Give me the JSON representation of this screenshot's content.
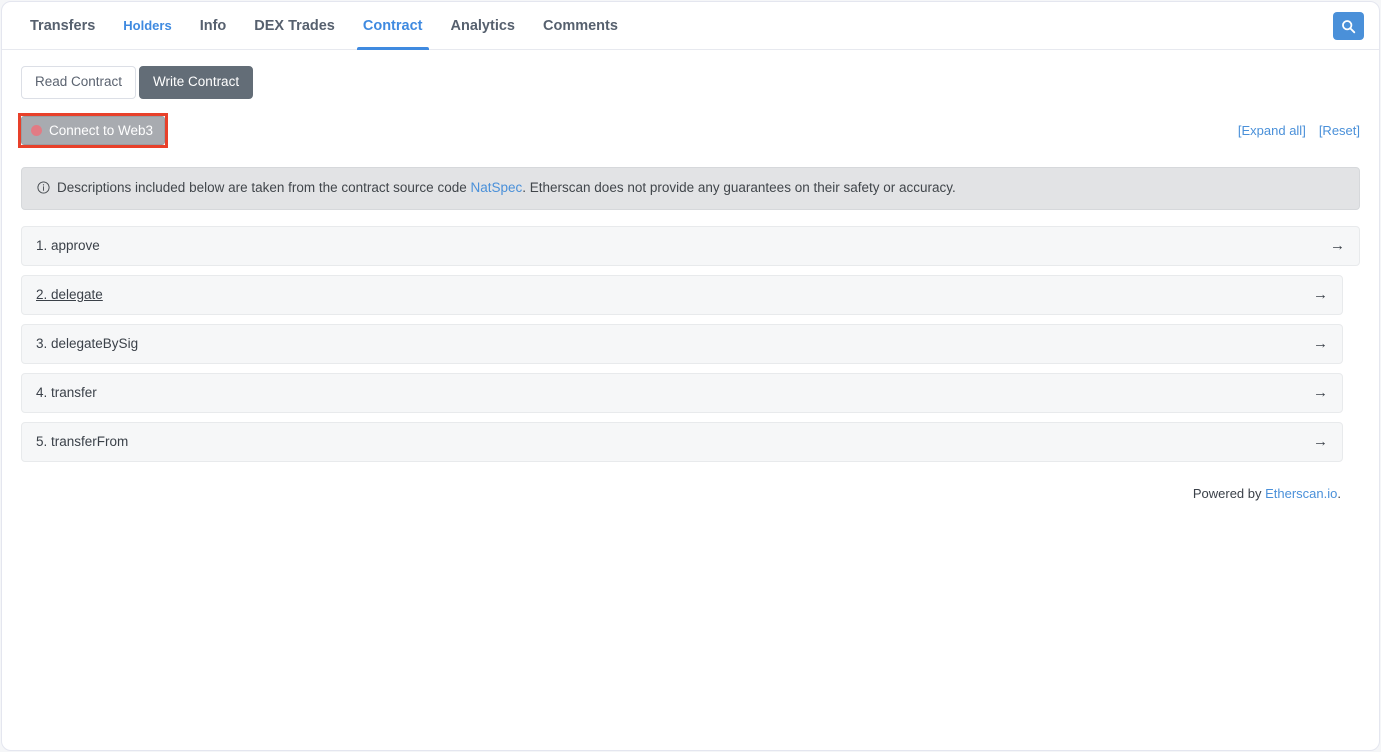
{
  "nav": {
    "tabs": [
      {
        "label": "Transfers",
        "state": "default"
      },
      {
        "label": "Holders",
        "state": "link"
      },
      {
        "label": "Info",
        "state": "default"
      },
      {
        "label": "DEX Trades",
        "state": "default"
      },
      {
        "label": "Contract",
        "state": "active"
      },
      {
        "label": "Analytics",
        "state": "default"
      },
      {
        "label": "Comments",
        "state": "default"
      }
    ],
    "search_icon": "search-icon"
  },
  "mode_buttons": {
    "read_label": "Read Contract",
    "write_label": "Write Contract",
    "active": "Write Contract"
  },
  "connect": {
    "label": "Connect to Web3",
    "status_dot_icon": "status-dot-icon",
    "status_dot_color": "#e27b84",
    "highlight_color": "#e8402a",
    "button_color": "#a8abb0"
  },
  "actions": {
    "expand_all": "[Expand all]",
    "reset": "[Reset]"
  },
  "notice": {
    "icon": "info-circle-icon",
    "text_before": "Descriptions included below are taken from the contract source code",
    "link_text": "NatSpec",
    "text_after": ". Etherscan does not provide any guarantees on their safety or accuracy."
  },
  "functions": [
    {
      "label": "1. approve",
      "arrow_icon": "arrow-right-icon",
      "hover": false,
      "expanded_width": true
    },
    {
      "label": "2. delegate",
      "arrow_icon": "arrow-right-icon",
      "hover": true,
      "expanded_width": false
    },
    {
      "label": "3. delegateBySig",
      "arrow_icon": "arrow-right-icon",
      "hover": false,
      "expanded_width": false
    },
    {
      "label": "4. transfer",
      "arrow_icon": "arrow-right-icon",
      "hover": false,
      "expanded_width": false
    },
    {
      "label": "5. transferFrom",
      "arrow_icon": "arrow-right-icon",
      "hover": false,
      "expanded_width": false
    }
  ],
  "footer": {
    "text_before": "Powered by ",
    "link_text": "Etherscan.io",
    "text_after": "."
  },
  "colors": {
    "accent_blue": "#4a90d9",
    "dark_button": "#636d77",
    "notice_bg": "#e2e3e5",
    "row_bg": "#f6f7f8"
  }
}
